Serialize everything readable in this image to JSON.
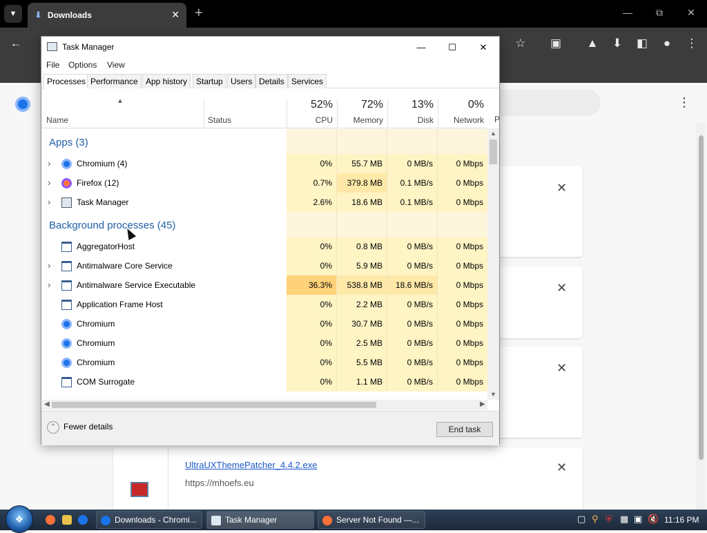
{
  "browser": {
    "tab_title": "Downloads",
    "new_tab": "+",
    "download_item": {
      "file_name": "UltraUXThemePatcher_4.4.2.exe",
      "source": "https://mhoefs.eu"
    }
  },
  "task_manager": {
    "title": "Task Manager",
    "menu": [
      "File",
      "Options",
      "View"
    ],
    "tabs": [
      "Processes",
      "Performance",
      "App history",
      "Startup",
      "Users",
      "Details",
      "Services"
    ],
    "active_tab": "Processes",
    "columns": {
      "name": "Name",
      "status": "Status",
      "cpu": {
        "pct": "52%",
        "label": "CPU"
      },
      "memory": {
        "pct": "72%",
        "label": "Memory"
      },
      "disk": {
        "pct": "13%",
        "label": "Disk"
      },
      "network": {
        "pct": "0%",
        "label": "Network"
      },
      "clipped": "P"
    },
    "groups": {
      "apps": "Apps (3)",
      "background": "Background processes (45)"
    },
    "apps": [
      {
        "name": "Chromium (4)",
        "cpu": "0%",
        "memory": "55.7 MB",
        "disk": "0 MB/s",
        "network": "0 Mbps",
        "icon": "chromium-icon"
      },
      {
        "name": "Firefox (12)",
        "cpu": "0.7%",
        "memory": "379.8 MB",
        "disk": "0.1 MB/s",
        "network": "0 Mbps",
        "icon": "firefox-icon"
      },
      {
        "name": "Task Manager",
        "cpu": "2.6%",
        "memory": "18.6 MB",
        "disk": "0.1 MB/s",
        "network": "0 Mbps",
        "icon": "task-manager-icon"
      }
    ],
    "background": [
      {
        "name": "AggregatorHost",
        "cpu": "0%",
        "memory": "0.8 MB",
        "disk": "0 MB/s",
        "network": "0 Mbps",
        "icon": "service-icon"
      },
      {
        "name": "Antimalware Core Service",
        "cpu": "0%",
        "memory": "5.9 MB",
        "disk": "0 MB/s",
        "network": "0 Mbps",
        "icon": "service-icon"
      },
      {
        "name": "Antimalware Service Executable",
        "cpu": "36.3%",
        "memory": "538.8 MB",
        "disk": "18.6 MB/s",
        "network": "0 Mbps",
        "icon": "service-icon"
      },
      {
        "name": "Application Frame Host",
        "cpu": "0%",
        "memory": "2.2 MB",
        "disk": "0 MB/s",
        "network": "0 Mbps",
        "icon": "service-icon"
      },
      {
        "name": "Chromium",
        "cpu": "0%",
        "memory": "30.7 MB",
        "disk": "0 MB/s",
        "network": "0 Mbps",
        "icon": "chromium-icon"
      },
      {
        "name": "Chromium",
        "cpu": "0%",
        "memory": "2.5 MB",
        "disk": "0 MB/s",
        "network": "0 Mbps",
        "icon": "chromium-icon"
      },
      {
        "name": "Chromium",
        "cpu": "0%",
        "memory": "5.5 MB",
        "disk": "0 MB/s",
        "network": "0 Mbps",
        "icon": "chromium-icon"
      },
      {
        "name": "COM Surrogate",
        "cpu": "0%",
        "memory": "1.1 MB",
        "disk": "0 MB/s",
        "network": "0 Mbps",
        "icon": "service-icon"
      }
    ],
    "footer": {
      "fewer_details": "Fewer details",
      "end_task": "End task"
    }
  },
  "taskbar": {
    "buttons": [
      {
        "label": "Downloads - Chromi..."
      },
      {
        "label": "Task Manager"
      },
      {
        "label": "Server Not Found —..."
      }
    ],
    "clock": "11:16 PM"
  },
  "colors": {
    "heat_low": "#fff4c4",
    "heat_mid": "#ffe9a8",
    "heat_high": "#ffd27a",
    "heat_empty": "#fdf5dc",
    "group_title": "#1f5fa8"
  }
}
